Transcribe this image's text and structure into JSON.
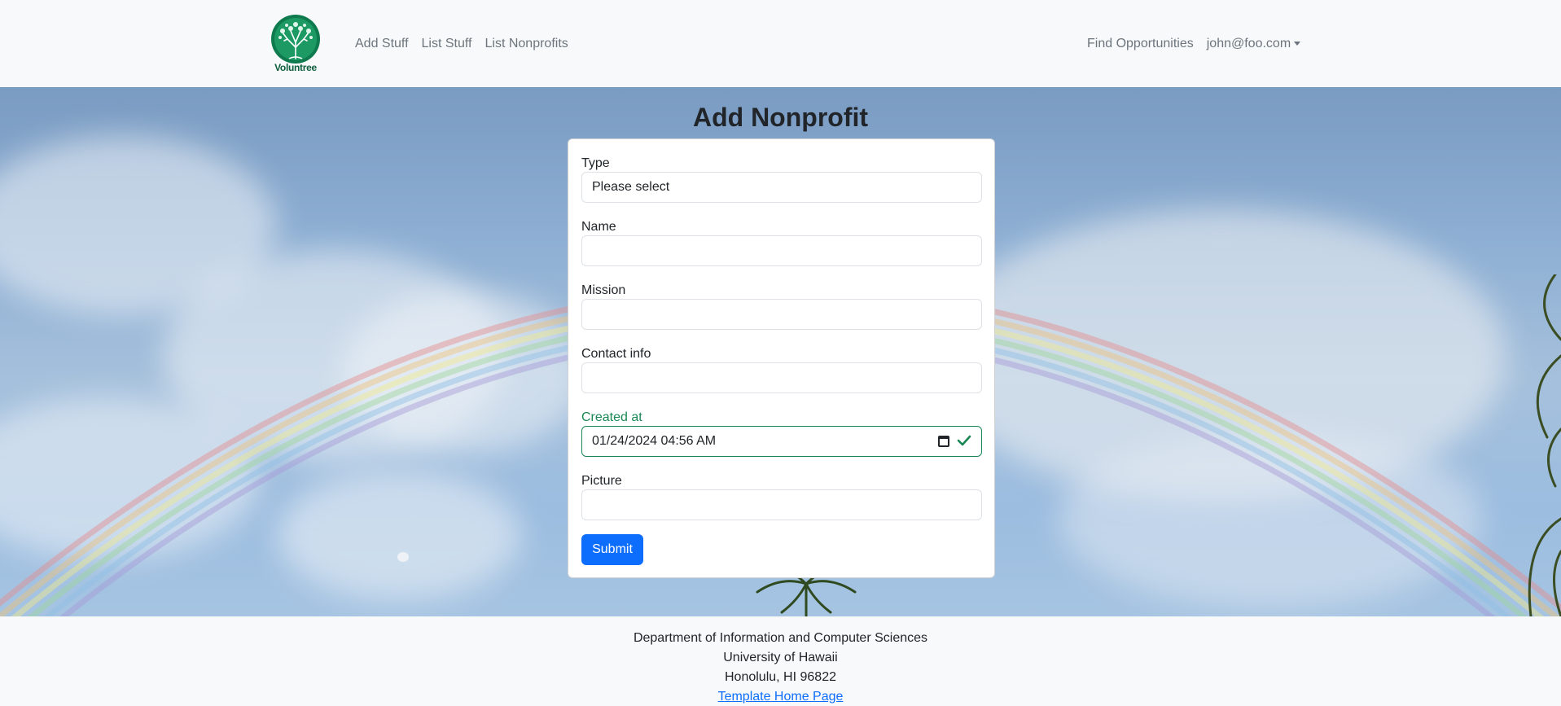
{
  "navbar": {
    "brand_text": "Voluntree",
    "left_links": [
      "Add Stuff",
      "List Stuff",
      "List Nonprofits"
    ],
    "find_label": "Find Opportunities",
    "user_label": "john@foo.com"
  },
  "page": {
    "title": "Add Nonprofit"
  },
  "form": {
    "type_label": "Type",
    "type_value": "Please select",
    "name_label": "Name",
    "name_value": "",
    "mission_label": "Mission",
    "mission_value": "",
    "contact_label": "Contact info",
    "contact_value": "",
    "created_label": "Created at",
    "created_value": "01/24/2024 04:56  AM",
    "picture_label": "Picture",
    "picture_value": "",
    "submit_label": "Submit"
  },
  "footer": {
    "line1": "Department of Information and Computer Sciences",
    "line2": "University of Hawaii",
    "line3": "Honolulu, HI 96822",
    "link": "Template Home Page"
  },
  "colors": {
    "primary": "#0d6efd",
    "valid": "#198754",
    "logo": "#0f7a4e"
  },
  "icons": [
    "voluntree-logo-icon",
    "caret-down-icon",
    "calendar-icon",
    "check-icon"
  ]
}
